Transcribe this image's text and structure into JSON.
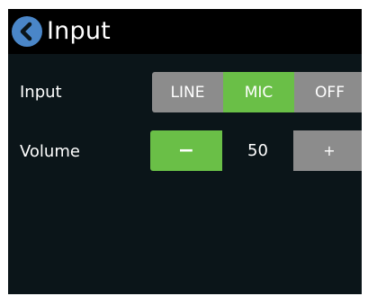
{
  "header": {
    "title": "Input",
    "back_icon": "chevron-left-icon",
    "back_color": "#4a86c8"
  },
  "input_row": {
    "label": "Input",
    "options": [
      "LINE",
      "MIC",
      "OFF"
    ],
    "selected": "MIC"
  },
  "volume_row": {
    "label": "Volume",
    "value": "50",
    "decrement_label": "−",
    "increment_label": "+"
  },
  "colors": {
    "active": "#6abf47",
    "inactive": "#8c8c8c",
    "background": "#0b1519",
    "header": "#000000"
  }
}
